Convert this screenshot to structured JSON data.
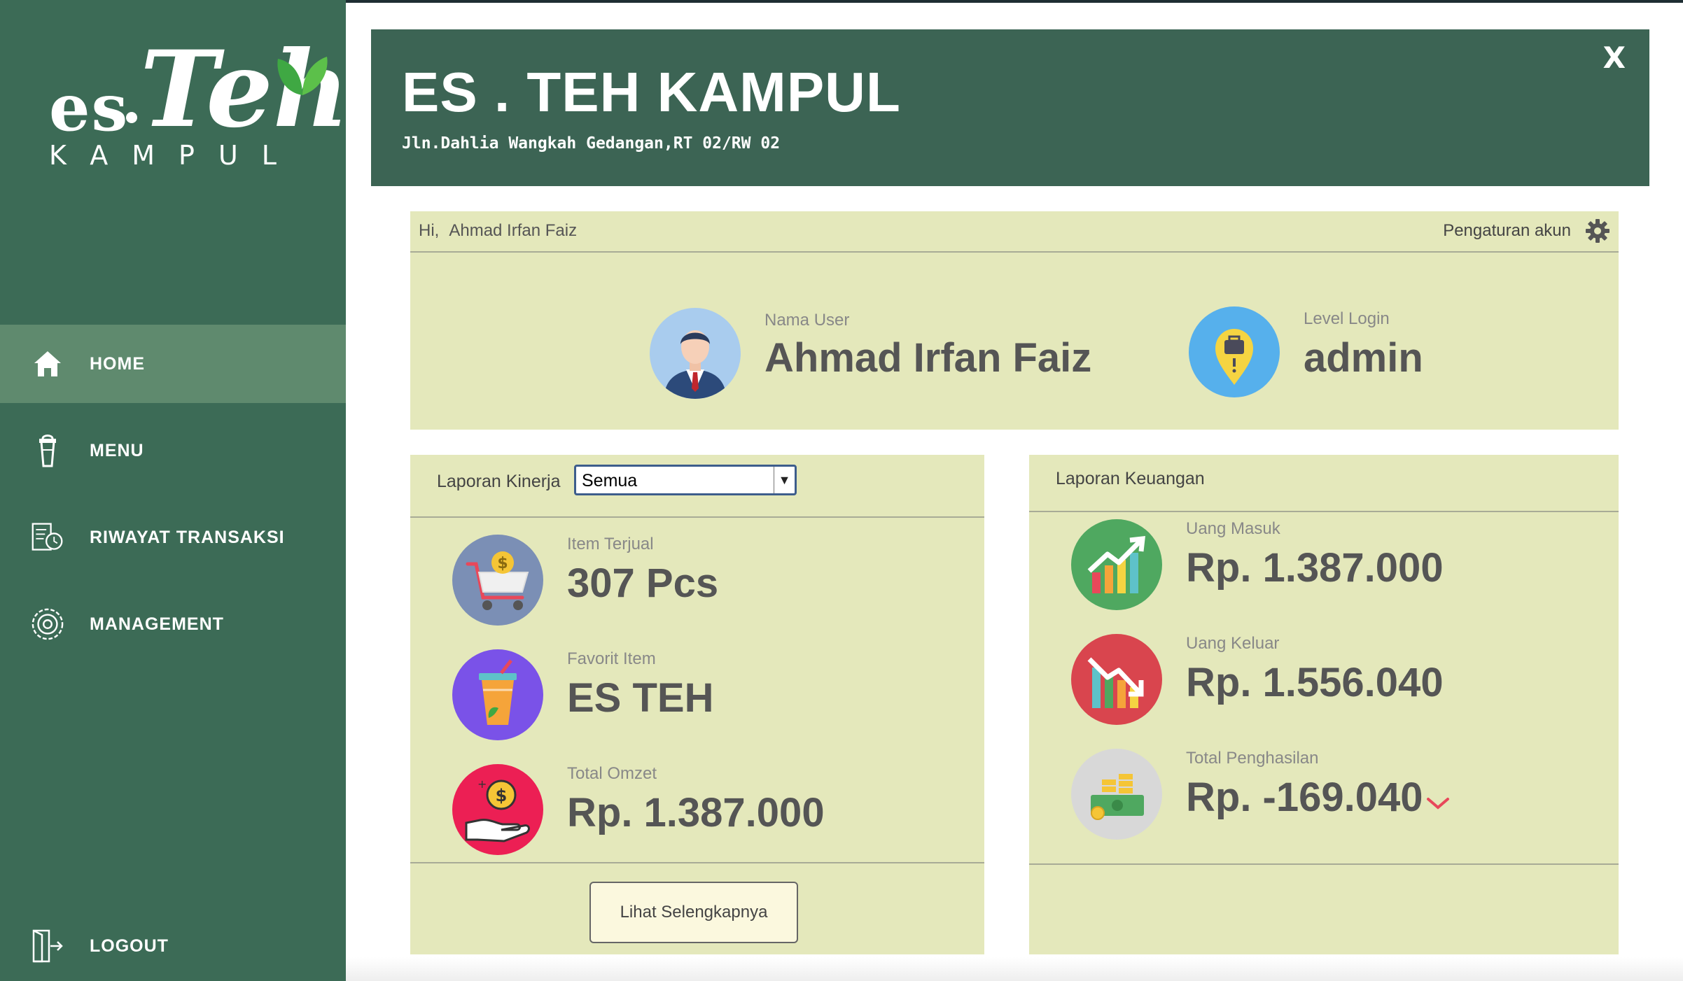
{
  "app": {
    "logo": {
      "es": "es",
      "teh": "Teh",
      "kampul": "KAMPUL"
    }
  },
  "sidebar": {
    "items": [
      {
        "label": "HOME",
        "icon": "home-icon",
        "active": true
      },
      {
        "label": "MENU",
        "icon": "drink-cup-icon",
        "active": false
      },
      {
        "label": "RIWAYAT TRANSAKSI",
        "icon": "transaction-history-icon",
        "active": false
      },
      {
        "label": "MANAGEMENT",
        "icon": "management-gear-icon",
        "active": false
      }
    ],
    "logout": {
      "label": "LOGOUT",
      "icon": "logout-door-icon"
    }
  },
  "header": {
    "title": "ES . TEH KAMPUL",
    "address": "Jln.Dahlia Wangkah Gedangan,RT 02/RW 02",
    "close_label": "X"
  },
  "user_panel": {
    "greeting": "Hi,",
    "greeting_name": "Ahmad Irfan Faiz",
    "settings_label": "Pengaturan akun",
    "nama_user_label": "Nama User",
    "nama_user_value": "Ahmad Irfan Faiz",
    "level_label": "Level Login",
    "level_value": "admin"
  },
  "kinerja": {
    "title": "Laporan Kinerja",
    "filter_selected": "Semua",
    "items": [
      {
        "label": "Item Terjual",
        "value": "307 Pcs",
        "icon": "shopping-cart-icon"
      },
      {
        "label": "Favorit Item",
        "value": "ES TEH",
        "icon": "iced-drink-icon"
      },
      {
        "label": "Total Omzet",
        "value": "Rp. 1.387.000",
        "icon": "money-hand-icon"
      }
    ],
    "more_button": "Lihat Selengkapnya"
  },
  "keuangan": {
    "title": "Laporan Keuangan",
    "items": [
      {
        "label": "Uang Masuk",
        "value": "Rp. 1.387.000",
        "icon": "chart-up-icon"
      },
      {
        "label": "Uang Keluar",
        "value": "Rp. 1.556.040",
        "icon": "chart-down-icon"
      },
      {
        "label": "Total Penghasilan",
        "value": "Rp. -169.040",
        "icon": "money-stack-icon"
      }
    ]
  },
  "colors": {
    "sidebar": "#3c6b56",
    "sidebar_active": "#5f8a6e",
    "header": "#3c6454",
    "panel": "#e4e8bb"
  }
}
